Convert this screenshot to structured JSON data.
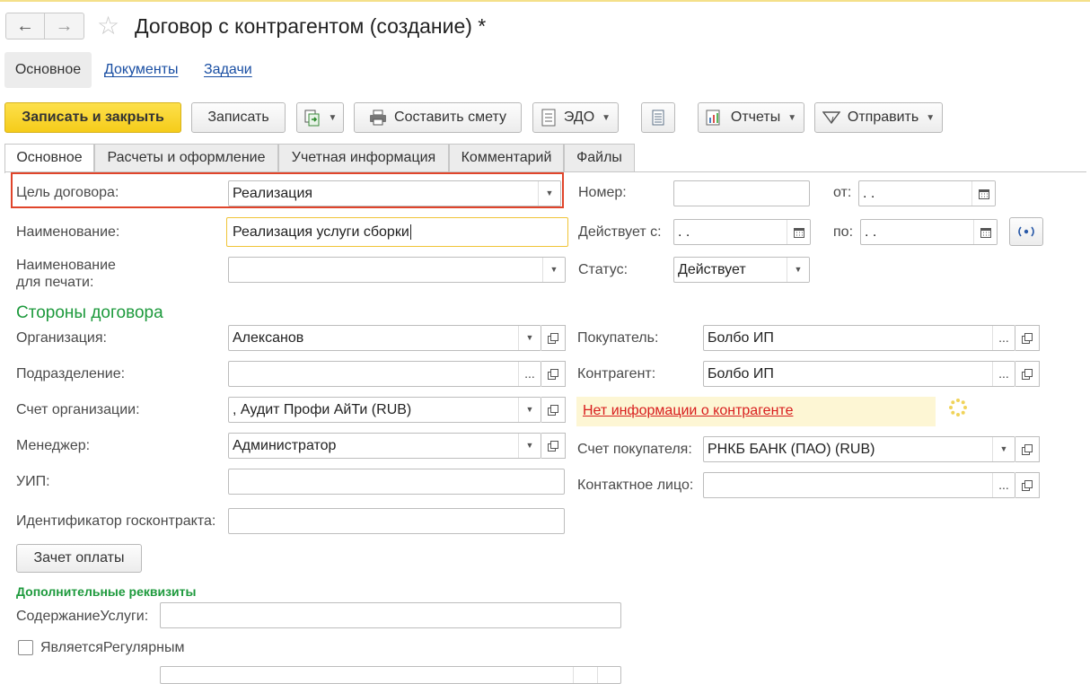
{
  "window": {
    "title": "Договор с контрагентом (создание) *",
    "nav_back": "←",
    "nav_forward": "→",
    "favorite_icon": "☆"
  },
  "sections": [
    "Основное",
    "Документы",
    "Задачи"
  ],
  "toolbar": {
    "save_close": "Записать и закрыть",
    "save": "Записать",
    "make_estimate": "Составить смету",
    "edo": "ЭДО",
    "reports": "Отчеты",
    "send": "Отправить"
  },
  "tabs": [
    "Основное",
    "Расчеты и оформление",
    "Учетная информация",
    "Комментарий",
    "Файлы"
  ],
  "form": {
    "purpose_label": "Цель договора:",
    "purpose_value": "Реализация",
    "name_label": "Наименование:",
    "name_value": "Реализация услуги сборки",
    "print_name_label_1": "Наименование",
    "print_name_label_2": "для печати:",
    "print_name_value": "",
    "number_label": "Номер:",
    "number_value": "",
    "from_label": "от:",
    "from_value": " .  .",
    "valid_from_label": "Действует с:",
    "valid_from_value": " .  .",
    "to_label": "по:",
    "to_value": " .  .",
    "status_label": "Статус:",
    "status_value": "Действует"
  },
  "parties": {
    "heading": "Стороны договора",
    "org_label": "Организация:",
    "org_value": "Алексанов",
    "dept_label": "Подразделение:",
    "dept_value": "",
    "account_label": "Счет организации:",
    "account_value": ", Аудит Профи АйТи (RUB)",
    "manager_label": "Менеджер:",
    "manager_value": "Администратор",
    "uip_label": "УИП:",
    "uip_value": "",
    "gov_label": "Идентификатор госконтракта:",
    "gov_value": "",
    "offset_button": "Зачет оплаты",
    "buyer_label": "Покупатель:",
    "buyer_value": "Болбо ИП",
    "counterparty_label": "Контрагент:",
    "counterparty_value": "Болбо ИП",
    "no_info_link": "Нет информации о контрагенте",
    "buyer_account_label": "Счет покупателя:",
    "buyer_account_value": "РНКБ БАНК (ПАО) (RUB)",
    "contact_label": "Контактное лицо:",
    "contact_value": ""
  },
  "extra": {
    "heading": "Дополнительные реквизиты",
    "service_label": "СодержаниеУслуги:",
    "service_value": "",
    "regular_label": "ЯвляетсяРегулярным",
    "regular_checked": false
  },
  "colors": {
    "primary_button": "#f5cc1a",
    "section_heading": "#1e9a3d",
    "link": "#1a4fa3",
    "warning_link": "#d81d1d",
    "highlight_border": "#e0452b"
  }
}
